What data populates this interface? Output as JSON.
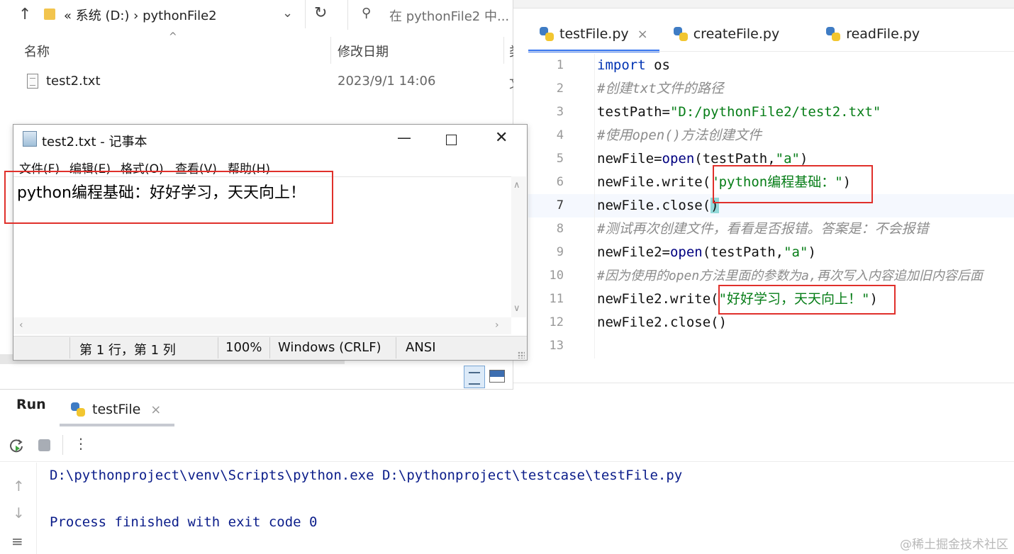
{
  "explorer": {
    "breadcrumb": "«  系统 (D:)  ›  pythonFile2",
    "search_placeholder": "在 pythonFile2 中...",
    "columns": {
      "name": "名称",
      "date": "修改日期",
      "type": "类"
    },
    "files": [
      {
        "name": "test2.txt",
        "modified": "2023/9/1 14:06",
        "type": "文"
      }
    ]
  },
  "notepad": {
    "title": "test2.txt - 记事本",
    "menus": [
      "文件(F)",
      "编辑(E)",
      "格式(O)",
      "查看(V)",
      "帮助(H)"
    ],
    "content": "python编程基础：好好学习，天天向上！",
    "status": {
      "position": "第 1 行，第 1 列",
      "zoom": "100%",
      "line_ending": "Windows (CRLF)",
      "encoding": "ANSI"
    }
  },
  "ide": {
    "tabs": [
      {
        "label": "testFile.py",
        "active": true
      },
      {
        "label": "createFile.py",
        "active": false
      },
      {
        "label": "readFile.py",
        "active": false
      }
    ],
    "lines": [
      "1",
      "2",
      "3",
      "4",
      "5",
      "6",
      "7",
      "8",
      "9",
      "10",
      "11",
      "12",
      "13"
    ],
    "code": {
      "l1_kw": "import",
      "l1_rest": " os",
      "l2": "#创建txt文件的路径",
      "l3_a": "testPath=",
      "l3_str": "\"D:/pythonFile2/test2.txt\"",
      "l4": "#使用open()方法创建文件",
      "l5_a": "newFile=",
      "l5_fn": "open",
      "l5_b": "(testPath,",
      "l5_str": "\"a\"",
      "l5_c": ")",
      "l6_a": "newFile.write(",
      "l6_str": "\"python编程基础：\"",
      "l6_c": ")",
      "l7_a": "newFile.close(",
      "l7_paren": ")",
      "l8": "#测试再次创建文件，看看是否报错。答案是：不会报错",
      "l9_a": "newFile2=",
      "l9_fn": "open",
      "l9_b": "(testPath,",
      "l9_str": "\"a\"",
      "l9_c": ")",
      "l10": "#因为使用的open方法里面的参数为a,再次写入内容追加旧内容后面",
      "l11_a": "newFile2.write(",
      "l11_str": "\"好好学习，天天向上！\"",
      "l11_c": ")",
      "l12": "newFile2.close()"
    }
  },
  "run": {
    "label": "Run",
    "tab": "testFile",
    "console": [
      "D:\\pythonproject\\venv\\Scripts\\python.exe D:\\pythonproject\\testcase\\testFile.py",
      "Process finished with exit code 0"
    ]
  },
  "watermark": "@稀土掘金技术社区",
  "colors": {
    "annotation_box": "#e0302b",
    "tab_active": "#3574f0",
    "console_text": "#0b1d8a"
  }
}
